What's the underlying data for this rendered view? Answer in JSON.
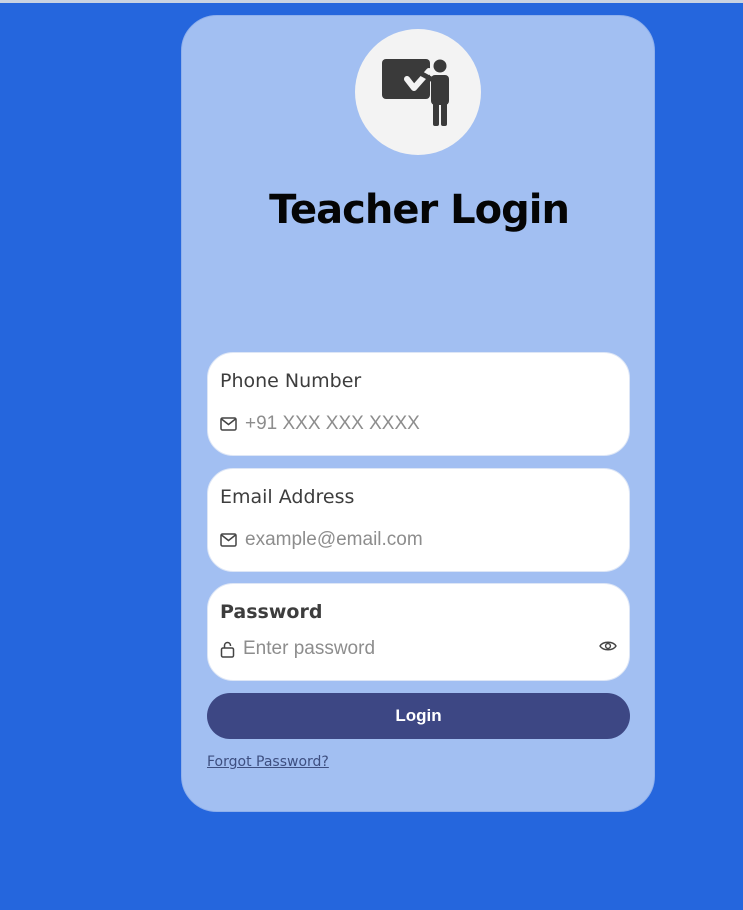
{
  "login": {
    "title": "Teacher Login",
    "avatar_icon": "teacher-at-board-icon",
    "phone": {
      "label": "Phone Number",
      "placeholder": "+91 XXX XXX XXXX",
      "icon": "mail-icon"
    },
    "email": {
      "label": "Email Address",
      "placeholder": "example@email.com",
      "icon": "mail-icon"
    },
    "password": {
      "label": "Password",
      "placeholder": "Enter password",
      "icon": "lock-icon",
      "toggle_icon": "eye-icon"
    },
    "button_label": "Login",
    "forgot_label": "Forgot Password?"
  },
  "colors": {
    "page_background": "#2566dd",
    "card_background": "#a2bff2",
    "button": "#3d4784",
    "avatar_background": "#f3f3f3"
  }
}
